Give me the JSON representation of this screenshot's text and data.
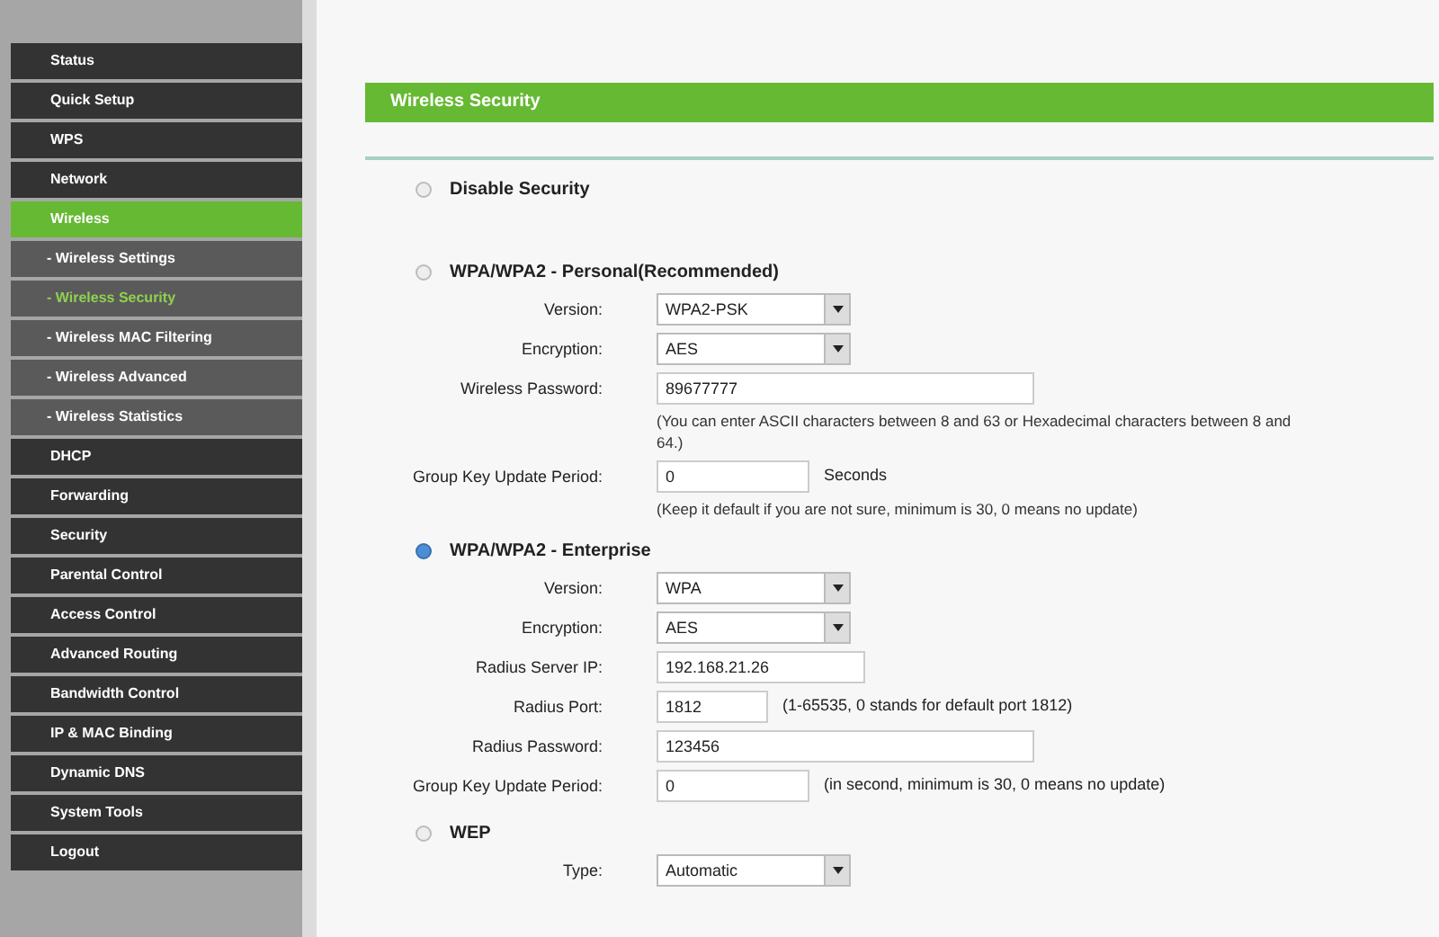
{
  "sidebar": {
    "items": [
      {
        "label": "Status",
        "kind": "main",
        "selected": false
      },
      {
        "label": "Quick Setup",
        "kind": "main",
        "selected": false
      },
      {
        "label": "WPS",
        "kind": "main",
        "selected": false
      },
      {
        "label": "Network",
        "kind": "main",
        "selected": false
      },
      {
        "label": "Wireless",
        "kind": "main",
        "selected": true
      },
      {
        "label": "- Wireless Settings",
        "kind": "sub",
        "selected": false
      },
      {
        "label": "- Wireless Security",
        "kind": "sub",
        "selected": true
      },
      {
        "label": "- Wireless MAC Filtering",
        "kind": "sub",
        "selected": false
      },
      {
        "label": "- Wireless Advanced",
        "kind": "sub",
        "selected": false
      },
      {
        "label": "- Wireless Statistics",
        "kind": "sub",
        "selected": false
      },
      {
        "label": "DHCP",
        "kind": "main",
        "selected": false
      },
      {
        "label": "Forwarding",
        "kind": "main",
        "selected": false
      },
      {
        "label": "Security",
        "kind": "main",
        "selected": false
      },
      {
        "label": "Parental Control",
        "kind": "main",
        "selected": false
      },
      {
        "label": "Access Control",
        "kind": "main",
        "selected": false
      },
      {
        "label": "Advanced Routing",
        "kind": "main",
        "selected": false
      },
      {
        "label": "Bandwidth Control",
        "kind": "main",
        "selected": false
      },
      {
        "label": "IP & MAC Binding",
        "kind": "main",
        "selected": false
      },
      {
        "label": "Dynamic DNS",
        "kind": "main",
        "selected": false
      },
      {
        "label": "System Tools",
        "kind": "main",
        "selected": false
      },
      {
        "label": "Logout",
        "kind": "main",
        "selected": false
      }
    ]
  },
  "page": {
    "title": "Wireless Security",
    "sections": [
      {
        "title": "Disable Security",
        "selected": false
      },
      {
        "title": "WPA/WPA2 - Personal(Recommended)",
        "selected": false,
        "fields": [
          {
            "kind": "select",
            "label": "Version:",
            "value": "WPA2-PSK"
          },
          {
            "kind": "select",
            "label": "Encryption:",
            "value": "AES"
          },
          {
            "kind": "wideinput",
            "label": "Wireless Password:",
            "value": "89677777",
            "note": "(You can enter ASCII characters between 8 and 63 or Hexadecimal characters between 8 and 64.)"
          },
          {
            "kind": "shortinput",
            "label": "Group Key Update Period:",
            "value": "0",
            "suffix": "Seconds",
            "note": "(Keep it default if you are not sure, minimum is 30, 0 means no update)"
          }
        ]
      },
      {
        "title": "WPA/WPA2 - Enterprise",
        "selected": true,
        "fields": [
          {
            "kind": "select",
            "label": "Version:",
            "value": "WPA"
          },
          {
            "kind": "select",
            "label": "Encryption:",
            "value": "AES"
          },
          {
            "kind": "midinput",
            "label": "Radius Server IP:",
            "value": "192.168.21.26"
          },
          {
            "kind": "tinyinput",
            "label": "Radius Port:",
            "value": "1812",
            "suffix": "(1-65535, 0 stands for default port 1812)"
          },
          {
            "kind": "wideinput",
            "label": "Radius Password:",
            "value": "123456"
          },
          {
            "kind": "shortinput",
            "label": "Group Key Update Period:",
            "value": "0",
            "suffix": "(in second, minimum is 30, 0 means no update)"
          }
        ]
      },
      {
        "title": "WEP",
        "selected": false,
        "fields": [
          {
            "kind": "select",
            "label": "Type:",
            "value": "Automatic"
          }
        ]
      }
    ]
  }
}
